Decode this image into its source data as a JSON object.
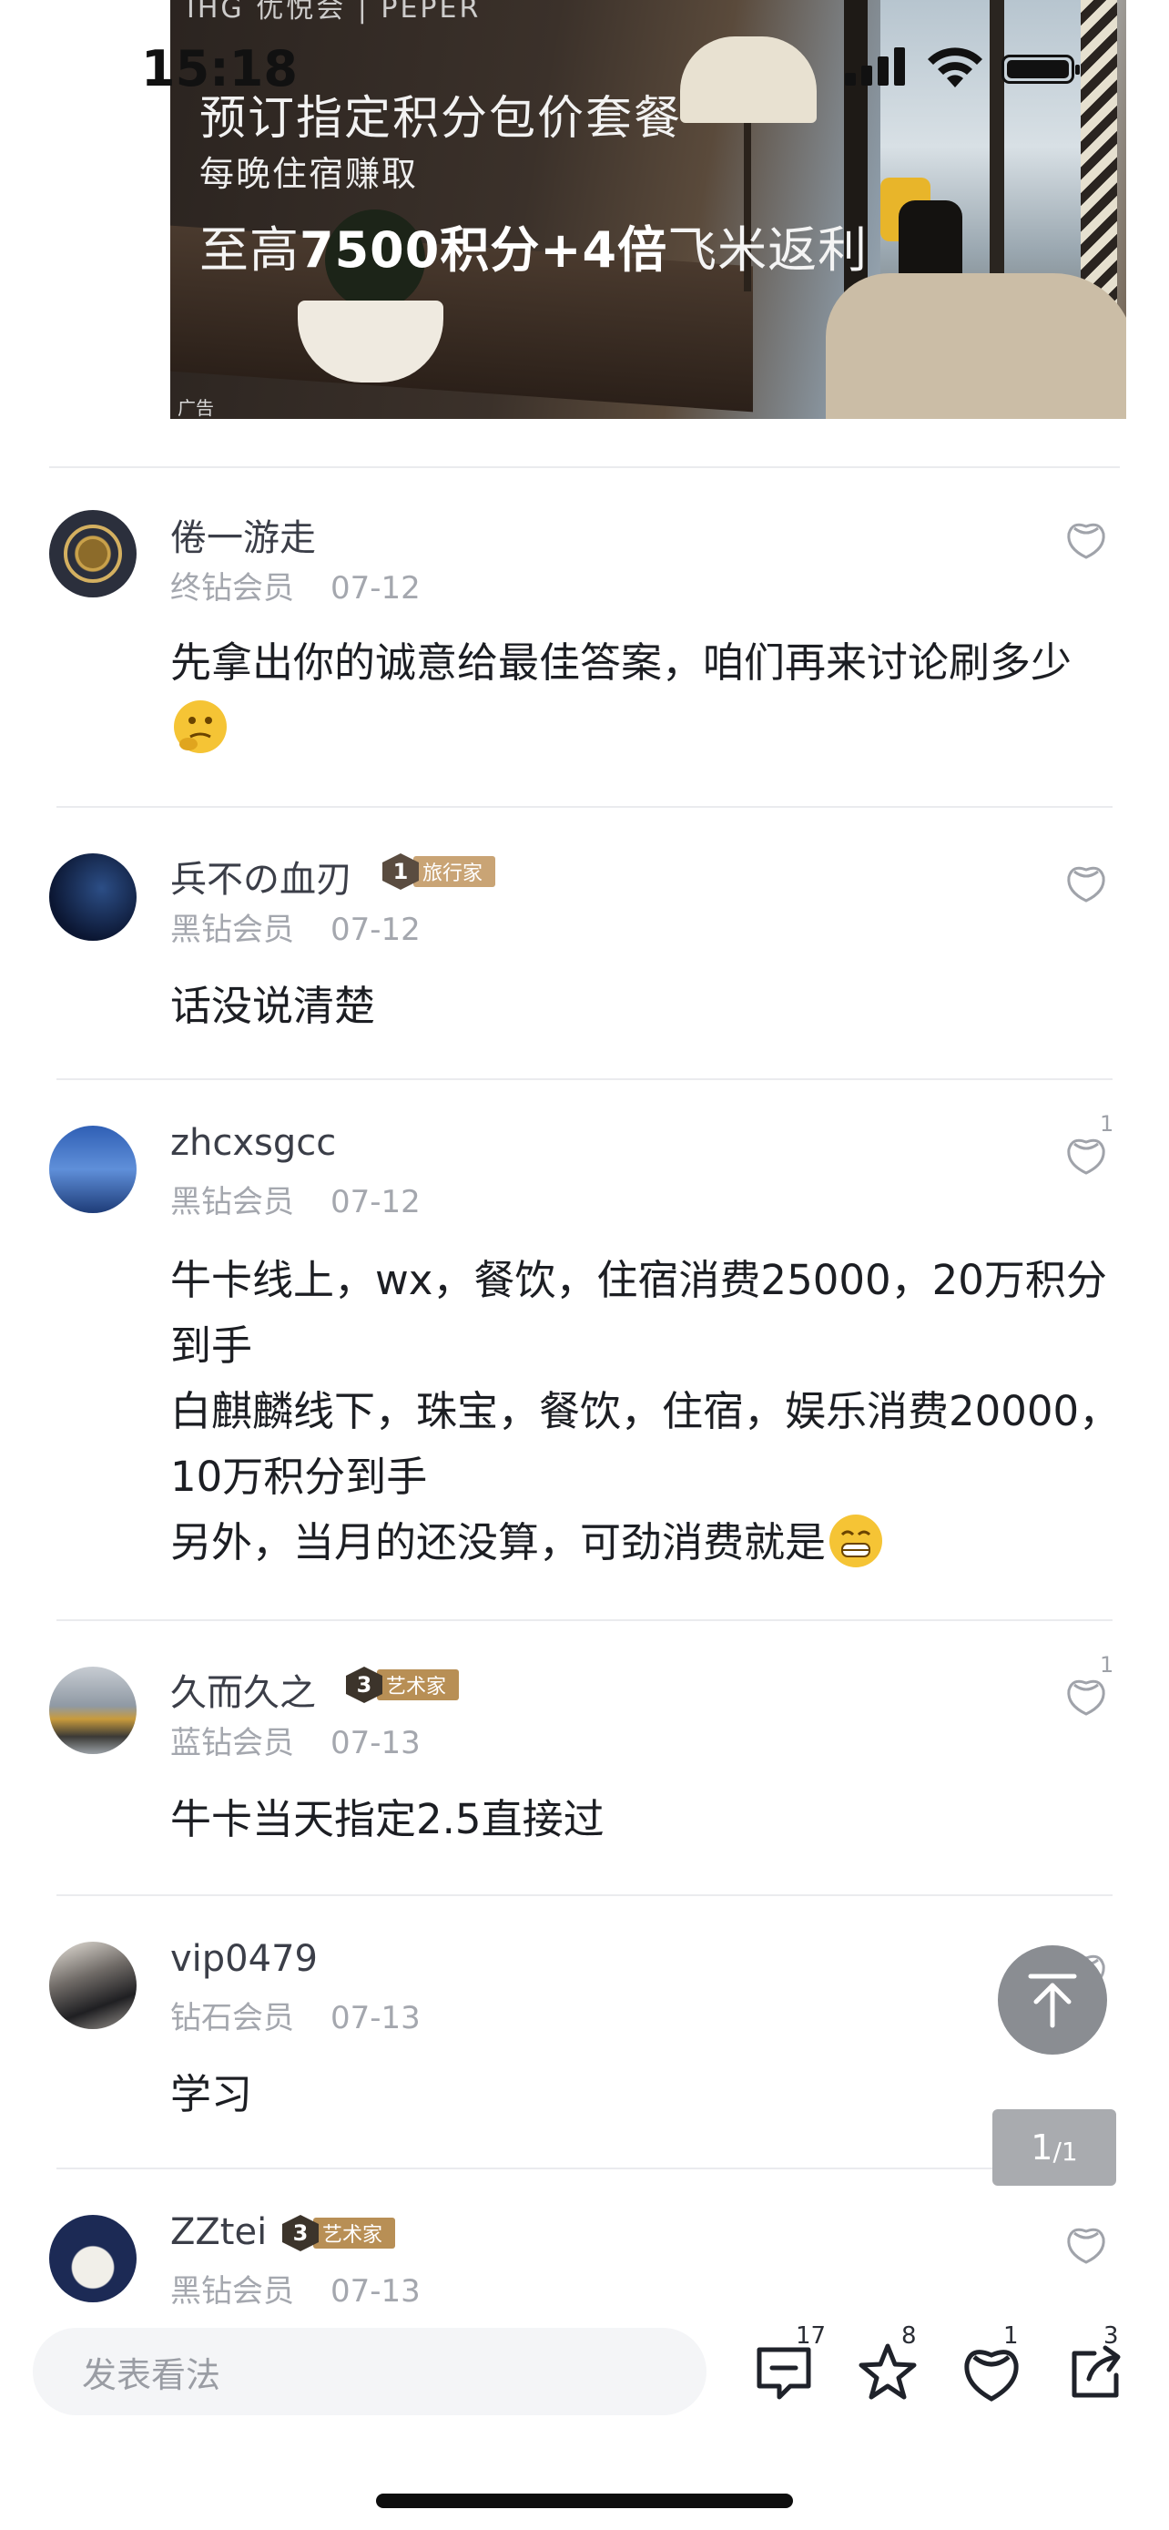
{
  "status_bar": {
    "time": "15:18"
  },
  "ad": {
    "title": "预订指定积分包价套餐",
    "subtitle": "每晚住宿赚取",
    "highlight_prefix": "至高",
    "highlight_bold": "7500积分+4倍",
    "highlight_suffix": "飞米返利",
    "tag": "广告",
    "logo": "IHG 优悦会 | PEPER"
  },
  "comments": [
    {
      "username": "倦一游走",
      "member_level": "终钻会员",
      "date": "07-12",
      "text": "先拿出你的诚意给最佳答案，咱们再来讨论刷多少",
      "emoji": "thinking-emoji",
      "likes": "",
      "badge": null
    },
    {
      "username": "兵不の血刃",
      "member_level": "黑钻会员",
      "date": "07-12",
      "text": "话没说清楚",
      "likes": "",
      "badge": {
        "level": "1",
        "label": "旅行家",
        "color": "#c9a475",
        "icon_color": "#5a4c40"
      }
    },
    {
      "username": "zhcxsgcc",
      "member_level": "黑钻会员",
      "date": "07-12",
      "text_lines": [
        "牛卡线上，wx，餐饮，住宿消费25000，20万积分到手",
        "白麒麟线下，珠宝，餐饮，住宿，娱乐消费20000，10万积分到手",
        "另外，当月的还没算，可劲消费就是"
      ],
      "emoji": "grinning-emoji",
      "likes": "1",
      "badge": null
    },
    {
      "username": "久而久之",
      "member_level": "蓝钻会员",
      "date": "07-13",
      "text": "牛卡当天指定2.5直接过",
      "likes": "1",
      "badge": {
        "level": "3",
        "label": "艺术家",
        "color": "#b88f55",
        "icon_color": "#3c342b"
      }
    },
    {
      "username": "vip0479",
      "member_level": "钻石会员",
      "date": "07-13",
      "text": "学习",
      "likes": "",
      "badge": null
    },
    {
      "username": "ZZtei",
      "member_level": "黑钻会员",
      "date": "07-13",
      "text": "",
      "likes": "",
      "badge": {
        "level": "3",
        "label": "艺术家",
        "color": "#b88f55",
        "icon_color": "#3c342b"
      }
    }
  ],
  "page_indicator": {
    "current": "1",
    "total": "/1"
  },
  "bottom_bar": {
    "input_placeholder": "发表看法",
    "comment_count": "17",
    "favorite_count": "8",
    "like_count": "1",
    "share_count": "3"
  }
}
